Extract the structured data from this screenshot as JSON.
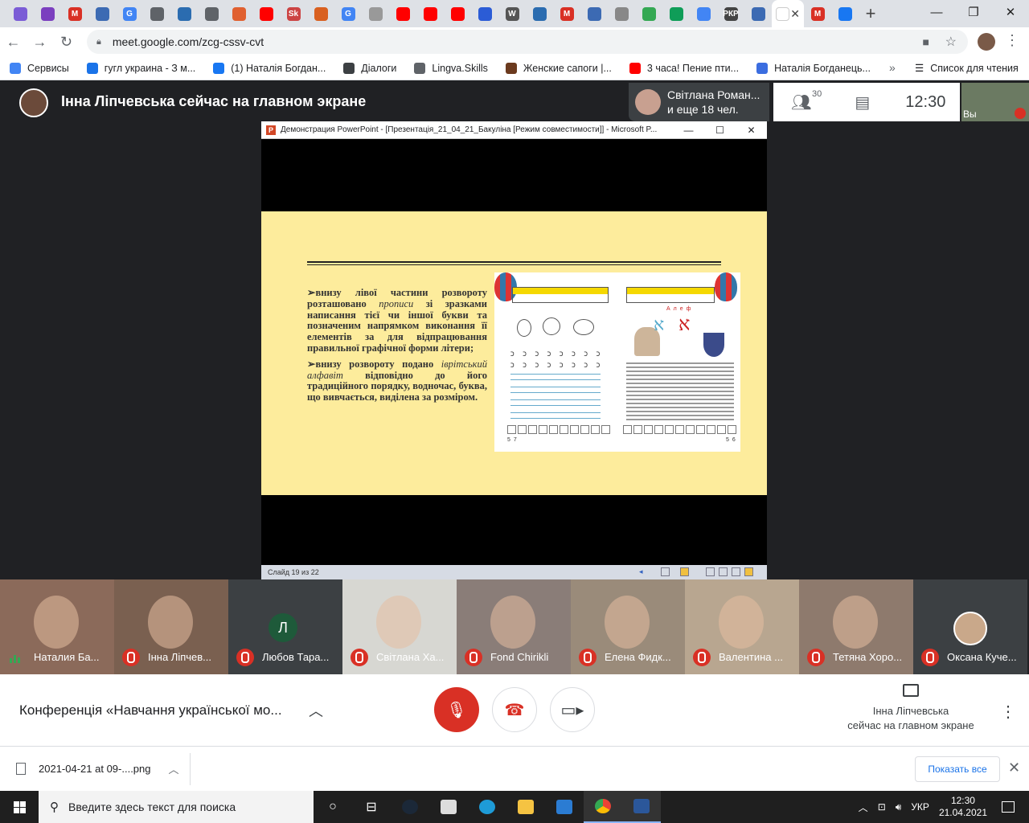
{
  "browser": {
    "url": "meet.google.com/zcg-cssv-cvt",
    "tab_colors": [
      "#7b5cd6",
      "#7b3fbf",
      "#d93025",
      "#3c6ab3",
      "#4285f4",
      "#5f6368",
      "#2b6cb0",
      "#5f6368",
      "#e06030",
      "#ff0000",
      "#c44",
      "#d96020",
      "#4285f4",
      "#999",
      "#ff0000",
      "#ff0000",
      "#ff0000",
      "#2b5cd6",
      "#555",
      "#2b6cb0",
      "#d93025",
      "#3c6ab3",
      "#888",
      "#34a853",
      "#0f9d58",
      "#4285f4",
      "#444",
      "#3c6ab3",
      "#ffffff",
      "#d93025",
      "#1877f2"
    ],
    "tab_labels": [
      "",
      "",
      "M",
      "",
      "G",
      "",
      "",
      "",
      "",
      "",
      "Sk",
      "",
      "G",
      "",
      "",
      "",
      "",
      "",
      "W",
      "",
      "M",
      "",
      "",
      "",
      "",
      "",
      "РКР",
      "",
      "",
      "M",
      ""
    ],
    "new_tab": "+",
    "window_controls": [
      "—",
      "❐",
      "✕"
    ],
    "bookmarks": [
      {
        "label": "Сервисы",
        "color": "#4285f4"
      },
      {
        "label": "гугл украина - З м...",
        "color": "#1a73e8"
      },
      {
        "label": "(1) Наталія Богдан...",
        "color": "#1877f2"
      },
      {
        "label": "Діалоги",
        "color": "#3c4043"
      },
      {
        "label": "Lingva.Skills",
        "color": "#5f6368"
      },
      {
        "label": "Женские сапоги |...",
        "color": "#6b3a1e"
      },
      {
        "label": "3 часа! Пение пти...",
        "color": "#ff0000"
      },
      {
        "label": "Наталія Богданець...",
        "color": "#3b6de0"
      }
    ],
    "bookmarks_more": "»",
    "reading_list": "Список для чтения"
  },
  "meet": {
    "presenter_banner": "Інна Ліпчевська сейчас на главном экране",
    "participants_card": {
      "line1": "Світлана Роман...",
      "line2": "и еще 18 чел."
    },
    "participant_count": "30",
    "clock": "12:30",
    "self_label": "Вы",
    "conference_title": "Конференція «Навчання української мо...",
    "presenting_line1": "Інна Ліпчевська",
    "presenting_line2": "сейчас на главном экране"
  },
  "ppt": {
    "window_title": "Демонстрация PowerPoint - [Презентація_21_04_21_Бакуліна [Режим совместимости]] - Microsoft P...",
    "status": "Слайд 19 из 22",
    "bullet1_a": "внизу лівої частини розвороту розташовано ",
    "bullet1_em": "прописи",
    "bullet1_b": " зі зразками написання тієї чи іншої букви та позначеним напрямком виконання її елементів за для відпрацювання правильної графічної форми літери;",
    "bullet2_a": "внизу розвороту подано ",
    "bullet2_em": "іврітський алфавіт",
    "bullet2_b": " відповідно до його традиційного порядку, водночас, буква, що вивчається, виділена за розміром.",
    "book_left_page": "57",
    "book_right_page": "56",
    "book_heading": "Алеф",
    "aleph_glyph": "א"
  },
  "tiles": [
    {
      "name": "Наталия Ба...",
      "bg": "#8b6a5a",
      "speaking": true
    },
    {
      "name": "Інна Ліпчев...",
      "bg": "#7a6050",
      "speaking": false
    },
    {
      "name": "Любов Тара...",
      "bg": "#3c4043",
      "letter": "Л",
      "speaking": false
    },
    {
      "name": "Світлана Ха...",
      "bg": "#d7d7d2",
      "speaking": false
    },
    {
      "name": "Fond Chirikli",
      "bg": "#8a7d78",
      "speaking": false
    },
    {
      "name": "Елена Фидк...",
      "bg": "#9a8b7a",
      "speaking": false
    },
    {
      "name": "Валентина ...",
      "bg": "#b8a690",
      "speaking": false
    },
    {
      "name": "Тетяна Хоро...",
      "bg": "#8e7a6d",
      "speaking": false
    },
    {
      "name": "Оксана Куче...",
      "bg": "#3c4043",
      "speaking": false
    }
  ],
  "download": {
    "file": "2021-04-21 at 09-....png",
    "show_all": "Показать все"
  },
  "taskbar": {
    "search_placeholder": "Введите здесь текст для поиска",
    "lang": "УКР",
    "time": "12:30",
    "date": "21.04.2021"
  }
}
